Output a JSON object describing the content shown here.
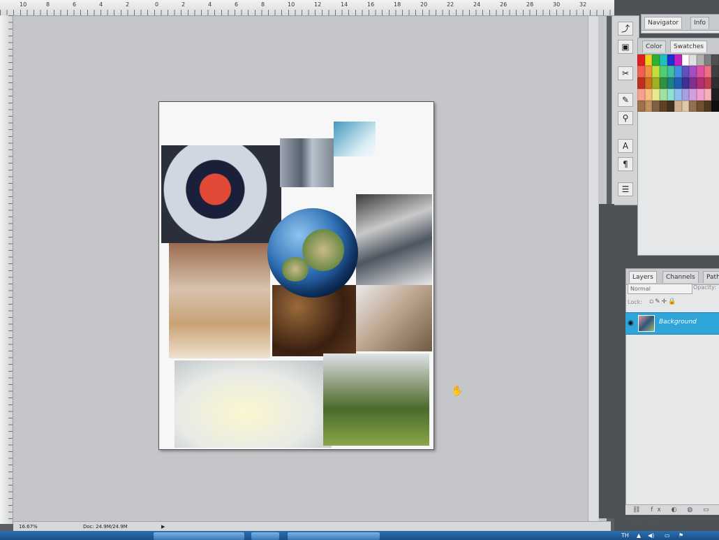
{
  "ruler": {
    "top_marks": [
      "10",
      "8",
      "6",
      "4",
      "2",
      "0",
      "2",
      "4",
      "6",
      "8",
      "10",
      "12",
      "14",
      "16",
      "18",
      "20",
      "22",
      "24",
      "26",
      "28",
      "30",
      "32"
    ]
  },
  "status": {
    "zoom": "16.67%",
    "doc_size": "Doc: 24.9M/24.9M"
  },
  "panels": {
    "top_tabs": [
      "Navigator",
      "Info"
    ],
    "color_tabs": [
      "Color",
      "Swatches"
    ],
    "layer_tabs": [
      "Layers",
      "Channels",
      "Paths"
    ],
    "blend_mode": "Normal",
    "opacity_label": "Opacity:",
    "lock_label": "Lock:",
    "layers": [
      {
        "name": "Background"
      }
    ]
  },
  "swatch_colors": [
    "#e02020",
    "#f0d020",
    "#30b030",
    "#20c0c0",
    "#2030d0",
    "#c020c0",
    "#ffffff",
    "#e0e0e0",
    "#b0b0b0",
    "#808080",
    "#505050",
    "#f06050",
    "#f09040",
    "#c0e040",
    "#50d070",
    "#40c0a0",
    "#4090e0",
    "#6050c0",
    "#a050c0",
    "#e050a0",
    "#f07080",
    "#404040",
    "#c03020",
    "#d07020",
    "#a0b020",
    "#309040",
    "#208080",
    "#2060b0",
    "#403090",
    "#803090",
    "#b03070",
    "#c04050",
    "#303030",
    "#f8a090",
    "#f8c080",
    "#e8e890",
    "#a0e0a0",
    "#90e0d0",
    "#90c0f0",
    "#a8a0e0",
    "#d0a0e0",
    "#f0a0d0",
    "#f8b0b8",
    "#202020",
    "#a0704a",
    "#c09060",
    "#806040",
    "#604020",
    "#403020",
    "#d0b090",
    "#e0c8a8",
    "#907050",
    "#705030",
    "#503820",
    "#101010"
  ],
  "taskbar": {
    "tray": [
      "TH",
      "▲",
      "◀)",
      "▭",
      "⚑"
    ]
  },
  "tools": {
    "icons": [
      "history-brush-icon",
      "frame-icon",
      "crop-icon",
      "brush-icon",
      "stamp-icon",
      "type-icon",
      "paragraph-icon",
      "layers-comp-icon"
    ]
  }
}
